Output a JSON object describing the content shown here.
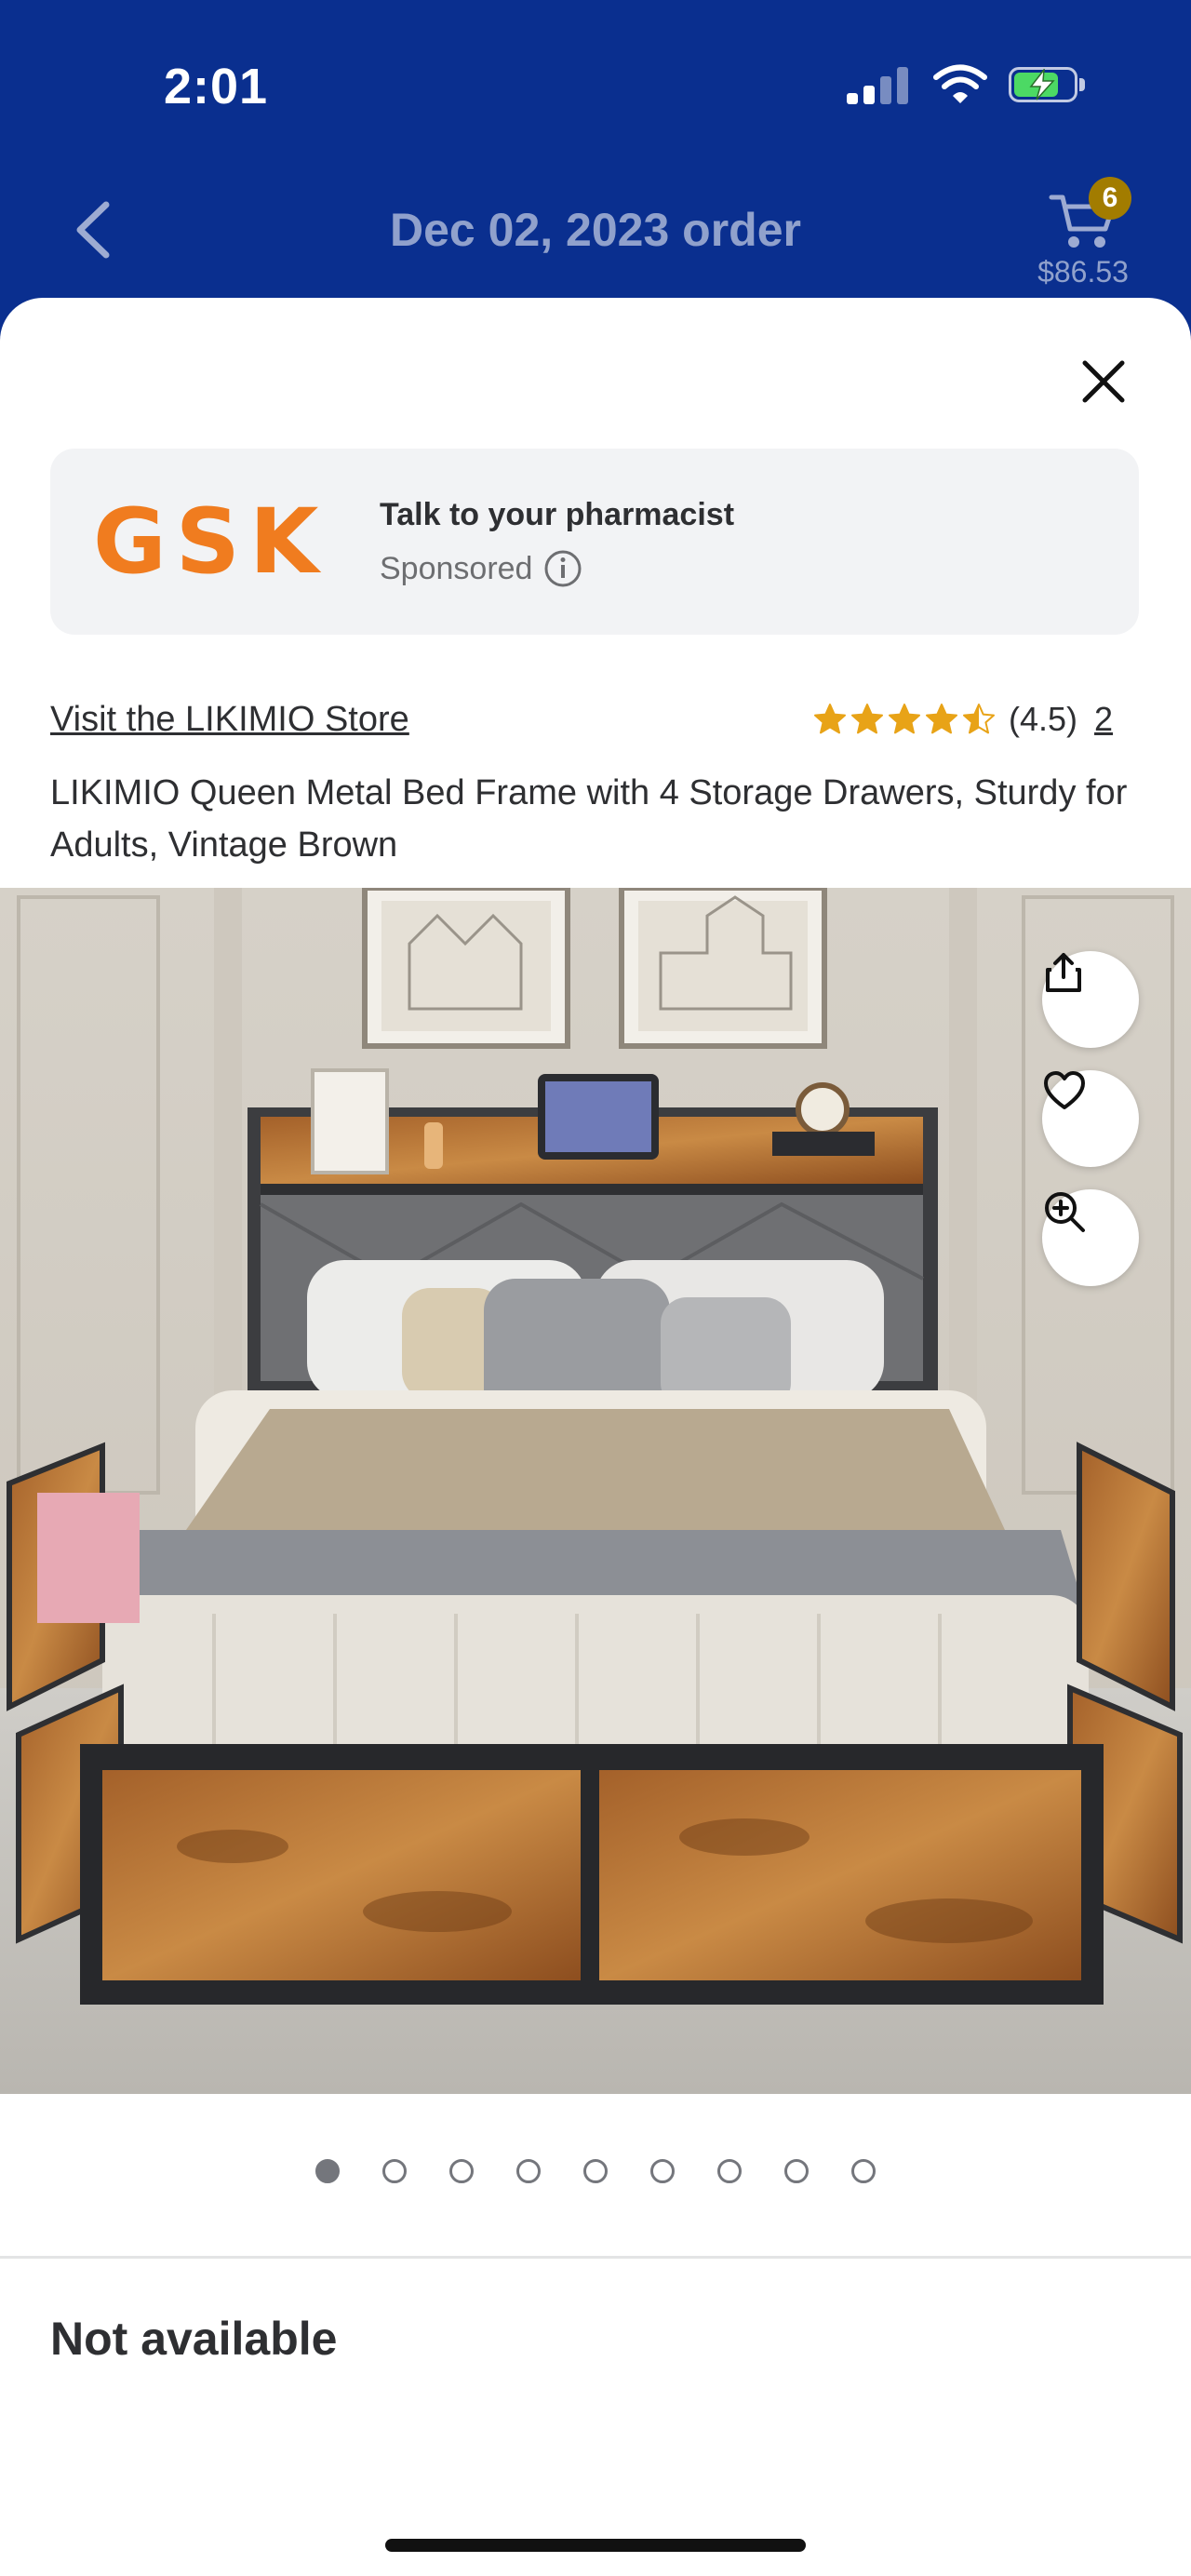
{
  "status_bar": {
    "time": "2:01",
    "battery_level": 0.75,
    "icons": [
      "cellular-signal-icon",
      "wifi-icon",
      "battery-charging-icon"
    ]
  },
  "header": {
    "back_icon": "chevron-left-icon",
    "title": "Dec 02, 2023 order",
    "cart": {
      "icon": "cart-icon",
      "badge_count": "6",
      "total": "$86.53"
    }
  },
  "modal": {
    "close_icon": "close-icon",
    "ad": {
      "brand_logo": "GSK",
      "title": "Talk to your pharmacist",
      "sponsored_label": "Sponsored",
      "info_icon": "info-icon"
    },
    "product": {
      "store_link": "Visit the LIKIMIO Store",
      "rating_value": 4.5,
      "rating_text": "(4.5)",
      "review_count": "2",
      "title": "LIKIMIO Queen Metal Bed Frame with 4 Storage Drawers, Sturdy for Adults, Vintage Brown",
      "image_actions": [
        "share-icon",
        "heart-icon",
        "zoom-in-icon"
      ],
      "carousel": {
        "total": 9,
        "active_index": 0
      },
      "availability": "Not available"
    }
  },
  "colors": {
    "header_blue": "#0a2f8f",
    "star_gold": "#e8a317",
    "gsk_orange": "#f07c1f",
    "cart_badge": "#a27c00",
    "text_dark": "#2e2f32"
  }
}
